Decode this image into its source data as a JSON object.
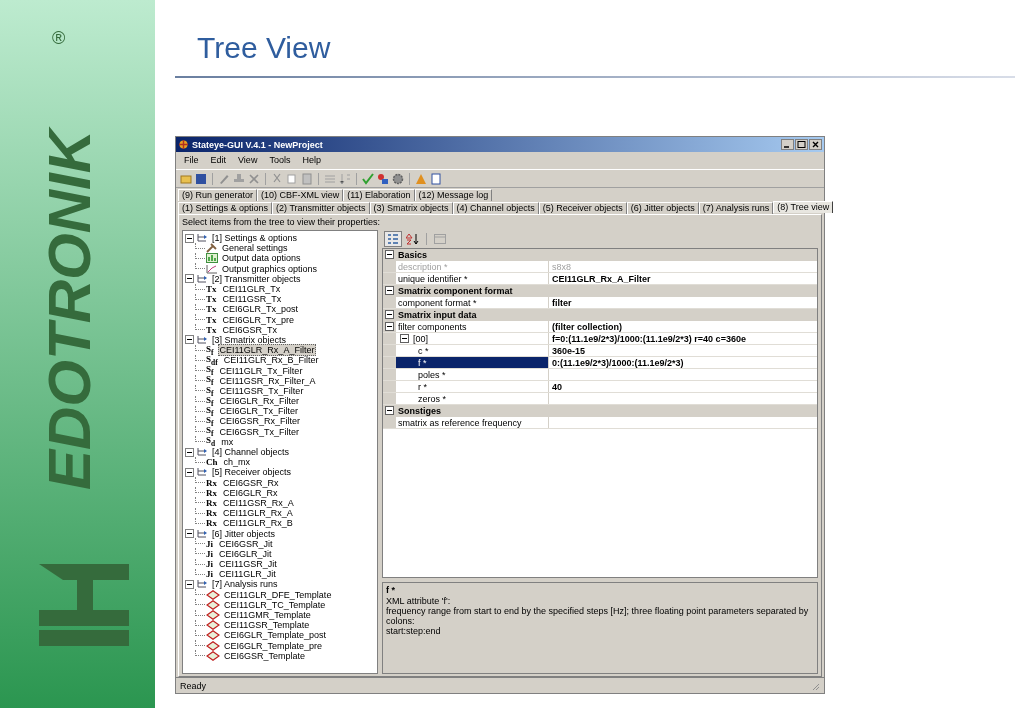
{
  "logo": {
    "text": "EDOTRONIK",
    "registered": "®"
  },
  "slide_title": "Tree View",
  "window": {
    "title": "Stateye-GUI V.4.1 - NewProject"
  },
  "menu": [
    "File",
    "Edit",
    "View",
    "Tools",
    "Help"
  ],
  "tab_rows": [
    [
      {
        "label": "(9) Run generator",
        "selected": false
      },
      {
        "label": "(10) CBF-XML view",
        "selected": false
      },
      {
        "label": "(11) Elaboration",
        "selected": false
      },
      {
        "label": "(12) Message log",
        "selected": false
      }
    ],
    [
      {
        "label": "(1) Settings & options",
        "selected": false
      },
      {
        "label": "(2) Transmitter objects",
        "selected": false
      },
      {
        "label": "(3) Smatrix objects",
        "selected": false
      },
      {
        "label": "(4) Channel objects",
        "selected": false
      },
      {
        "label": "(5) Receiver objects",
        "selected": false
      },
      {
        "label": "(6) Jitter objects",
        "selected": false
      },
      {
        "label": "(7) Analysis runs",
        "selected": false
      },
      {
        "label": "(8) Tree view",
        "selected": true
      }
    ]
  ],
  "hint": "Select items from the tree to view their properties:",
  "tree": [
    {
      "label": "[1] Settings & options",
      "expanded": true,
      "selected": false,
      "children": [
        {
          "label": "General settings",
          "kind": "tools",
          "selected": false
        },
        {
          "label": "Output data options",
          "kind": "table",
          "selected": false
        },
        {
          "label": "Output graphics options",
          "kind": "graph",
          "selected": false
        }
      ]
    },
    {
      "label": "[2] Transmitter objects",
      "expanded": true,
      "selected": false,
      "children": [
        {
          "badge": "Tx",
          "label": "CEI11GLR_Tx",
          "selected": false
        },
        {
          "badge": "Tx",
          "label": "CEI11GSR_Tx",
          "selected": false
        },
        {
          "badge": "Tx",
          "label": "CEI6GLR_Tx_post",
          "selected": false
        },
        {
          "badge": "Tx",
          "label": "CEI6GLR_Tx_pre",
          "selected": false
        },
        {
          "badge": "Tx",
          "label": "CEI6GSR_Tx",
          "selected": false
        }
      ]
    },
    {
      "label": "[3] Smatrix objects",
      "expanded": true,
      "selected": false,
      "children": [
        {
          "badge": "S$_{f}$",
          "label": "CEI11GLR_Rx_A_Filter",
          "selected": true
        },
        {
          "badge": "S$_{df}$",
          "label": "CEI11GLR_Rx_B_Filter",
          "selected": false
        },
        {
          "badge": "S$_{f}$",
          "label": "CEI11GLR_Tx_Filter",
          "selected": false
        },
        {
          "badge": "S$_{f}$",
          "label": "CEI11GSR_Rx_Filter_A",
          "selected": false
        },
        {
          "badge": "S$_{f}$",
          "label": "CEI11GSR_Tx_Filter",
          "selected": false
        },
        {
          "badge": "S$_{f}$",
          "label": "CEI6GLR_Rx_Filter",
          "selected": false
        },
        {
          "badge": "S$_{f}$",
          "label": "CEI6GLR_Tx_Filter",
          "selected": false
        },
        {
          "badge": "S$_{f}$",
          "label": "CEI6GSR_Rx_Filter",
          "selected": false
        },
        {
          "badge": "S$_{f}$",
          "label": "CEI6GSR_Tx_Filter",
          "selected": false
        },
        {
          "badge": "S$_{d}$",
          "label": "mx",
          "selected": false
        }
      ]
    },
    {
      "label": "[4] Channel objects",
      "expanded": true,
      "selected": false,
      "children": [
        {
          "badge": "Ch",
          "label": "ch_mx",
          "selected": false
        }
      ]
    },
    {
      "label": "[5] Receiver objects",
      "expanded": true,
      "selected": false,
      "children": [
        {
          "badge": "Rx",
          "label": "CEI6GSR_Rx",
          "selected": false
        },
        {
          "badge": "Rx",
          "label": "CEI6GLR_Rx",
          "selected": false
        },
        {
          "badge": "Rx",
          "label": "CEI11GSR_Rx_A",
          "selected": false
        },
        {
          "badge": "Rx",
          "label": "CEI11GLR_Rx_A",
          "selected": false
        },
        {
          "badge": "Rx",
          "label": "CEI11GLR_Rx_B",
          "selected": false
        }
      ]
    },
    {
      "label": "[6] Jitter objects",
      "expanded": true,
      "selected": false,
      "children": [
        {
          "badge": "Ji",
          "label": "CEI6GSR_Jit",
          "selected": false
        },
        {
          "badge": "Ji",
          "label": "CEI6GLR_Jit",
          "selected": false
        },
        {
          "badge": "Ji",
          "label": "CEI11GSR_Jit",
          "selected": false
        },
        {
          "badge": "Ji",
          "label": "CEI11GLR_Jit",
          "selected": false
        }
      ]
    },
    {
      "label": "[7] Analysis runs",
      "expanded": true,
      "selected": false,
      "children": [
        {
          "label": "CEI11GLR_DFE_Template",
          "kind": "run",
          "selected": false
        },
        {
          "label": "CEI11GLR_TC_Template",
          "kind": "run",
          "selected": false
        },
        {
          "label": "CEI11GMR_Template",
          "kind": "run",
          "selected": false
        },
        {
          "label": "CEI11GSR_Template",
          "kind": "run",
          "selected": false
        },
        {
          "label": "CEI6GLR_Template_post",
          "kind": "run",
          "selected": false
        },
        {
          "label": "CEI6GLR_Template_pre",
          "kind": "run",
          "selected": false
        },
        {
          "label": "CEI6GSR_Template",
          "kind": "run",
          "selected": false
        }
      ]
    }
  ],
  "properties": [
    {
      "title": "Basics",
      "expanded": true,
      "rows": [
        {
          "name": "description *",
          "value": "s8x8",
          "disabled": true,
          "selected": false
        },
        {
          "name": "unique identifier *",
          "value": "CEI11GLR_Rx_A_Filter",
          "disabled": false,
          "selected": false
        }
      ]
    },
    {
      "title": "Smatrix component format",
      "expanded": true,
      "rows": [
        {
          "name": "component format *",
          "value": "filter",
          "disabled": false,
          "selected": false
        }
      ]
    },
    {
      "title": "Smatrix input data",
      "expanded": true,
      "rows": [
        {
          "name": "filter components",
          "value": "(filter collection)",
          "disabled": false,
          "selected": false,
          "expanded": true,
          "children": [
            {
              "name": "[00]",
              "value": "f=0:(11.1e9/2*3)/1000:(11.1e9/2*3) r=40 c=360e",
              "disabled": false,
              "selected": false,
              "expanded": true,
              "children": [
                {
                  "name": "c *",
                  "value": "360e-15",
                  "disabled": false,
                  "selected": false
                },
                {
                  "name": "f *",
                  "value": "0:(11.1e9/2*3)/1000:(11.1e9/2*3)",
                  "disabled": false,
                  "selected": true
                },
                {
                  "name": "poles *",
                  "disabled": false,
                  "selected": false
                },
                {
                  "name": "r *",
                  "value": "40",
                  "disabled": false,
                  "selected": false
                },
                {
                  "name": "zeros *",
                  "disabled": false,
                  "selected": false
                }
              ]
            }
          ]
        }
      ]
    },
    {
      "title": "Sonstiges",
      "expanded": true,
      "rows": [
        {
          "name": "smatrix as reference frequency",
          "disabled": false,
          "selected": false
        }
      ]
    }
  ],
  "description": {
    "title": "f *",
    "lines": [
      "XML attribute 'f':",
      "frequency range from start to end by the specified steps [Hz]; three floating point parameters separated by colons:",
      "start:step:end"
    ]
  },
  "status": "Ready"
}
